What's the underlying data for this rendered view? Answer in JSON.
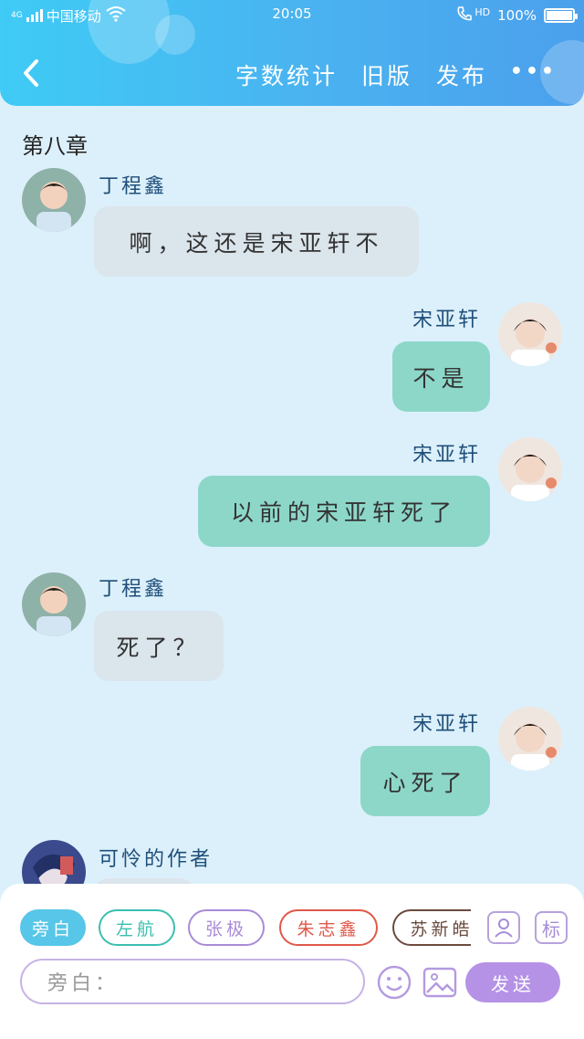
{
  "status": {
    "network": "4G",
    "carrier": "中国移动",
    "time": "20:05",
    "hd": "HD",
    "battery": "100%"
  },
  "nav": {
    "word_count": "字数统计",
    "old_version": "旧版",
    "publish": "发布",
    "more": "•••"
  },
  "chapter_title": "第八章",
  "messages": [
    {
      "sender": "丁程鑫",
      "text": "啊，这还是宋亚轩不",
      "side": "left"
    },
    {
      "sender": "宋亚轩",
      "text": "不是",
      "side": "right"
    },
    {
      "sender": "宋亚轩",
      "text": "以前的宋亚轩死了",
      "side": "right"
    },
    {
      "sender": "丁程鑫",
      "text": "死了？",
      "side": "left"
    },
    {
      "sender": "宋亚轩",
      "text": "心死了",
      "side": "right"
    },
    {
      "sender": "可怜的作者",
      "text": "",
      "side": "left"
    }
  ],
  "roles": [
    "旁白",
    "左航",
    "张极",
    "朱志鑫",
    "苏新皓"
  ],
  "colors": {
    "chip_narration": "#57c6e8",
    "chip_zuohang": "#3bbfb0",
    "chip_zhangji": "#a98bd8",
    "chip_zhuzhixin": "#e0584a",
    "chip_suxinhao": "#6b4b3e"
  },
  "tools": {
    "role_icon": "role-icon",
    "tag_label": "标"
  },
  "composer": {
    "placeholder": "旁白：",
    "send": "发送"
  }
}
